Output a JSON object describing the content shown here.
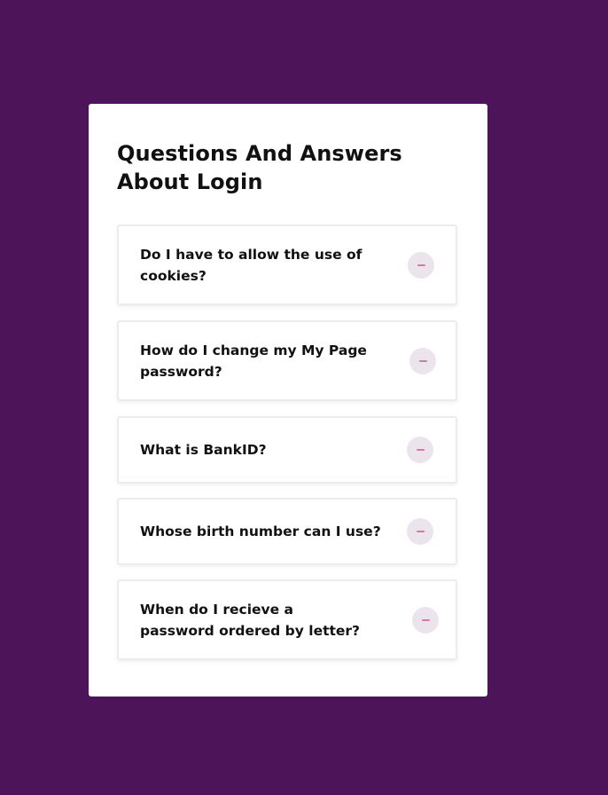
{
  "faq": {
    "title": "Questions And Answers About Login",
    "items": [
      {
        "question": "Do I have to allow the use of cookies?",
        "toggle_icon": "minus-icon",
        "expanded": true
      },
      {
        "question": "How do I change my My Page password?",
        "toggle_icon": "minus-icon",
        "expanded": true
      },
      {
        "question": "What is BankID?",
        "toggle_icon": "minus-icon",
        "expanded": true
      },
      {
        "question": "Whose birth number can I use?",
        "toggle_icon": "minus-icon",
        "expanded": true
      },
      {
        "question": "When do I recieve a password ordered by letter?",
        "toggle_icon": "minus-icon",
        "expanded": true
      }
    ]
  },
  "colors": {
    "background": "#4d1459",
    "card": "#ffffff",
    "toggle_bg": "#ece4ec",
    "toggle_icon": "#d7789e",
    "text": "#111111"
  }
}
